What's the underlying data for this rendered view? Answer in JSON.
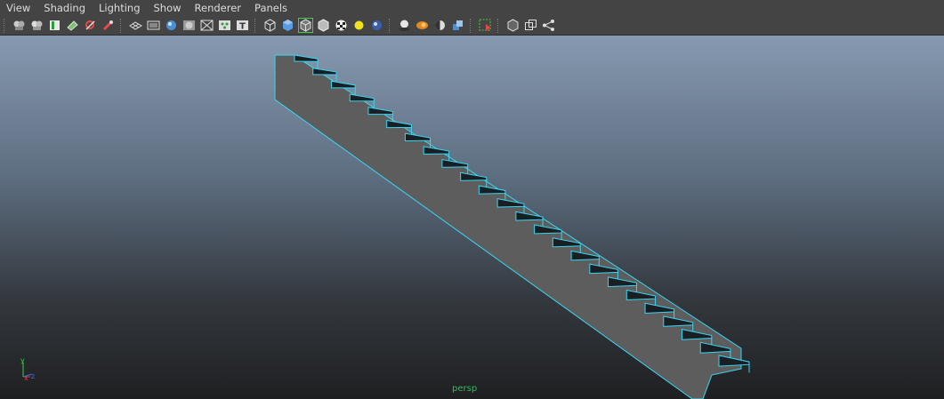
{
  "menu": {
    "items": [
      "View",
      "Shading",
      "Lighting",
      "Show",
      "Renderer",
      "Panels"
    ]
  },
  "toolbar": {
    "icons": [
      "camera-select-icon",
      "camera-attributes-icon",
      "bookmark-icon",
      "image-plane-icon",
      "grease-pencil-icon",
      "two-d-pan-zoom-icon",
      "grid-icon",
      "film-gate-icon",
      "resolution-gate-icon",
      "gate-mask-icon",
      "field-chart-icon",
      "safe-action-icon",
      "safe-title-icon",
      "wireframe-icon",
      "smooth-shade-icon",
      "wireframe-on-shaded-icon",
      "default-material-icon",
      "textured-icon",
      "use-all-lights-icon",
      "shadows-icon",
      "screen-space-ao-icon",
      "motion-blur-icon",
      "multisample-aa-icon",
      "depth-of-field-icon",
      "isolate-select-icon",
      "xray-icon",
      "xray-active-components-icon",
      "xray-joints-icon"
    ]
  },
  "viewport": {
    "camera_label": "persp",
    "axis": {
      "x_label": "x",
      "y_label": "y",
      "z_label": "z"
    },
    "colors": {
      "selection_highlight": "#3ad6f2",
      "stringer_fill": "#5d5d5d",
      "step_fill": "#1a1f24",
      "camera_label": "#2fbf5a",
      "axis_x": "#e0383b",
      "axis_y": "#38d04a",
      "axis_z": "#3a6fe0"
    }
  }
}
